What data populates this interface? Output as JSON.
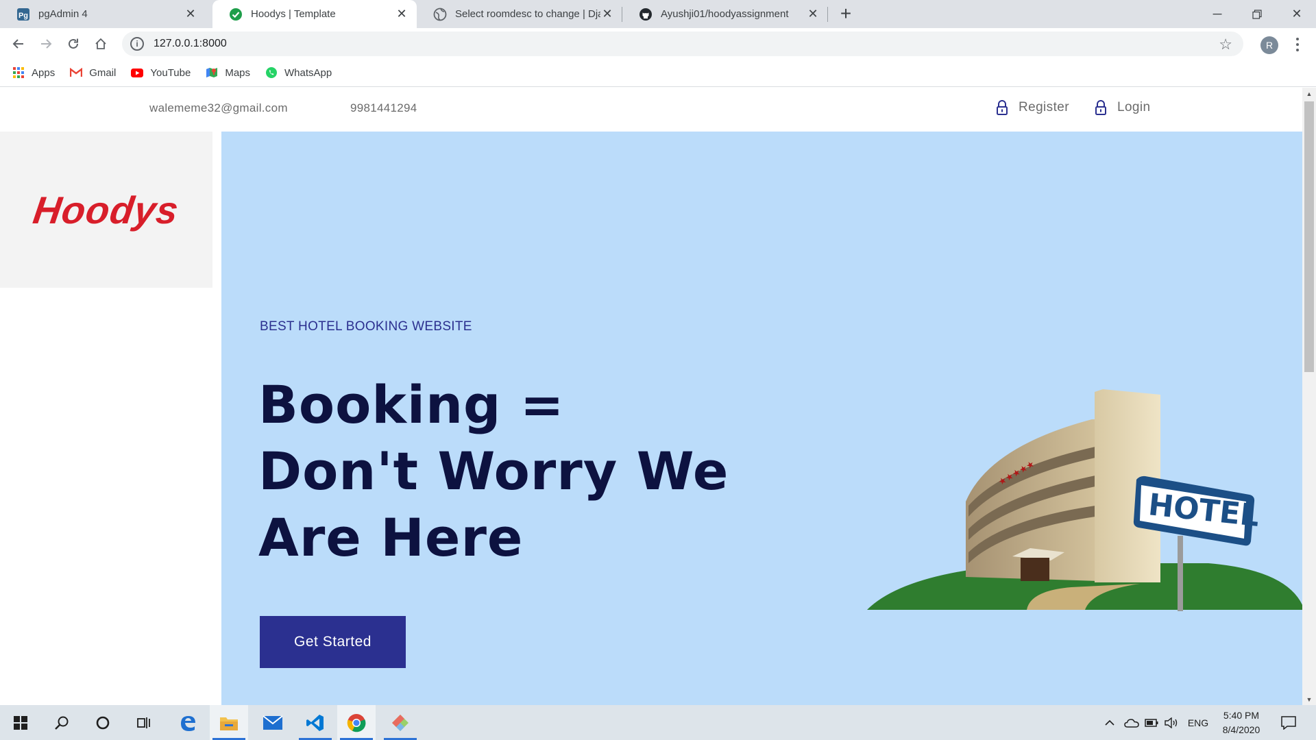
{
  "browser": {
    "tabs": [
      {
        "title": "pgAdmin 4",
        "icon": "pgadmin-icon",
        "active": false
      },
      {
        "title": "Hoodys | Template",
        "icon": "check-circle-icon",
        "active": true
      },
      {
        "title": "Select roomdesc to change | Djar",
        "icon": "globe-icon",
        "active": false
      },
      {
        "title": "Ayushji01/hoodyassignment",
        "icon": "github-icon",
        "active": false
      }
    ],
    "url": "127.0.0.1:8000",
    "profile_initial": "R",
    "bookmarks": [
      {
        "label": "Apps",
        "icon": "apps-grid-icon"
      },
      {
        "label": "Gmail",
        "icon": "gmail-icon"
      },
      {
        "label": "YouTube",
        "icon": "youtube-icon"
      },
      {
        "label": "Maps",
        "icon": "maps-icon"
      },
      {
        "label": "WhatsApp",
        "icon": "whatsapp-icon"
      }
    ]
  },
  "site": {
    "topbar": {
      "email": "walememe32@gmail.com",
      "phone": "9981441294",
      "register": "Register",
      "login": "Login"
    },
    "logo": "Hoodys",
    "hero": {
      "kicker": "BEST HOTEL BOOKING WEBSITE",
      "headline": "Booking = Don't Worry We Are Here",
      "cta": "Get Started",
      "sign_text": "HOTEL"
    },
    "colors": {
      "hero_bg": "#bbdcfa",
      "cta_bg": "#2b3090",
      "logo": "#d81e2a",
      "headline": "#0d1240"
    }
  },
  "taskbar": {
    "language": "ENG",
    "time": "5:40 PM",
    "date": "8/4/2020"
  }
}
